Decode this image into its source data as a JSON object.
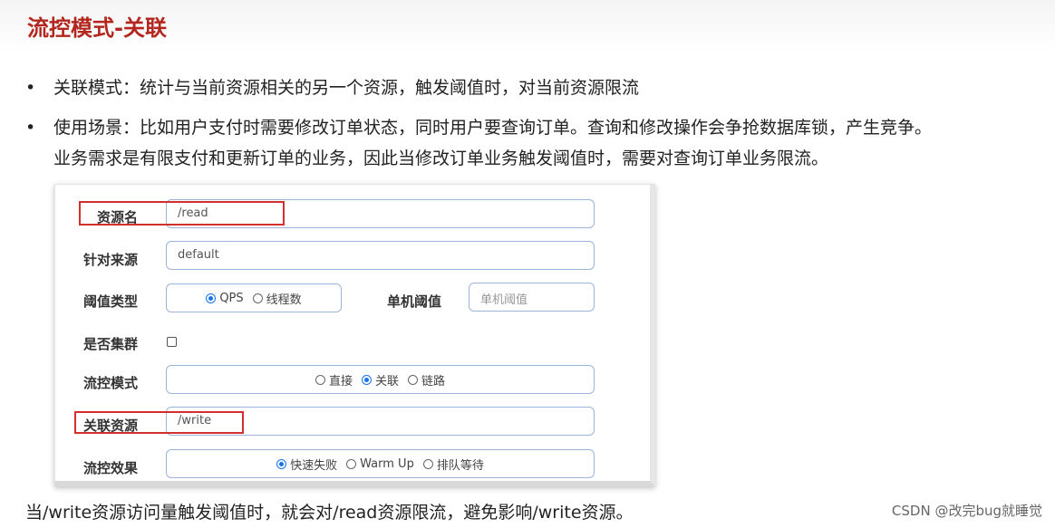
{
  "page_title": "流控模式-关联",
  "bullets": [
    {
      "lines": [
        "关联模式：统计与当前资源相关的另一个资源，触发阈值时，对当前资源限流"
      ]
    },
    {
      "lines": [
        "使用场景：比如用户支付时需要修改订单状态，同时用户要查询订单。查询和修改操作会争抢数据库锁，产生竞争。",
        "业务需求是有限支付和更新订单的业务，因此当修改订单业务触发阈值时，需要对查询订单业务限流。"
      ]
    }
  ],
  "bullet_glyph": "•",
  "form": {
    "resource_name": {
      "label": "资源名",
      "value": "/read"
    },
    "limit_app": {
      "label": "针对来源",
      "value": "default"
    },
    "threshold_type": {
      "label": "阈值类型",
      "options": [
        {
          "label": "QPS",
          "selected": true
        },
        {
          "label": "线程数",
          "selected": false
        }
      ]
    },
    "single_threshold": {
      "label": "单机阈值",
      "placeholder": "单机阈值"
    },
    "cluster": {
      "label": "是否集群",
      "checked": false
    },
    "flow_mode": {
      "label": "流控模式",
      "options": [
        {
          "label": "直接",
          "selected": false
        },
        {
          "label": "关联",
          "selected": true
        },
        {
          "label": "链路",
          "selected": false
        }
      ]
    },
    "ref_resource": {
      "label": "关联资源",
      "value": "/write"
    },
    "flow_effect": {
      "label": "流控效果",
      "options": [
        {
          "label": "快速失败",
          "selected": true
        },
        {
          "label": "Warm Up",
          "selected": false
        },
        {
          "label": "排队等待",
          "selected": false
        }
      ]
    }
  },
  "footer_text": "当/write资源访问量触发阈值时，就会对/read资源限流，避免影响/write资源。",
  "watermark": "CSDN @改完bug就睡觉",
  "colors": {
    "title": "#b3261e",
    "highlight_box": "#d32f2f",
    "radio_selected": "#1a73e8",
    "field_border": "#9cb4d6"
  }
}
